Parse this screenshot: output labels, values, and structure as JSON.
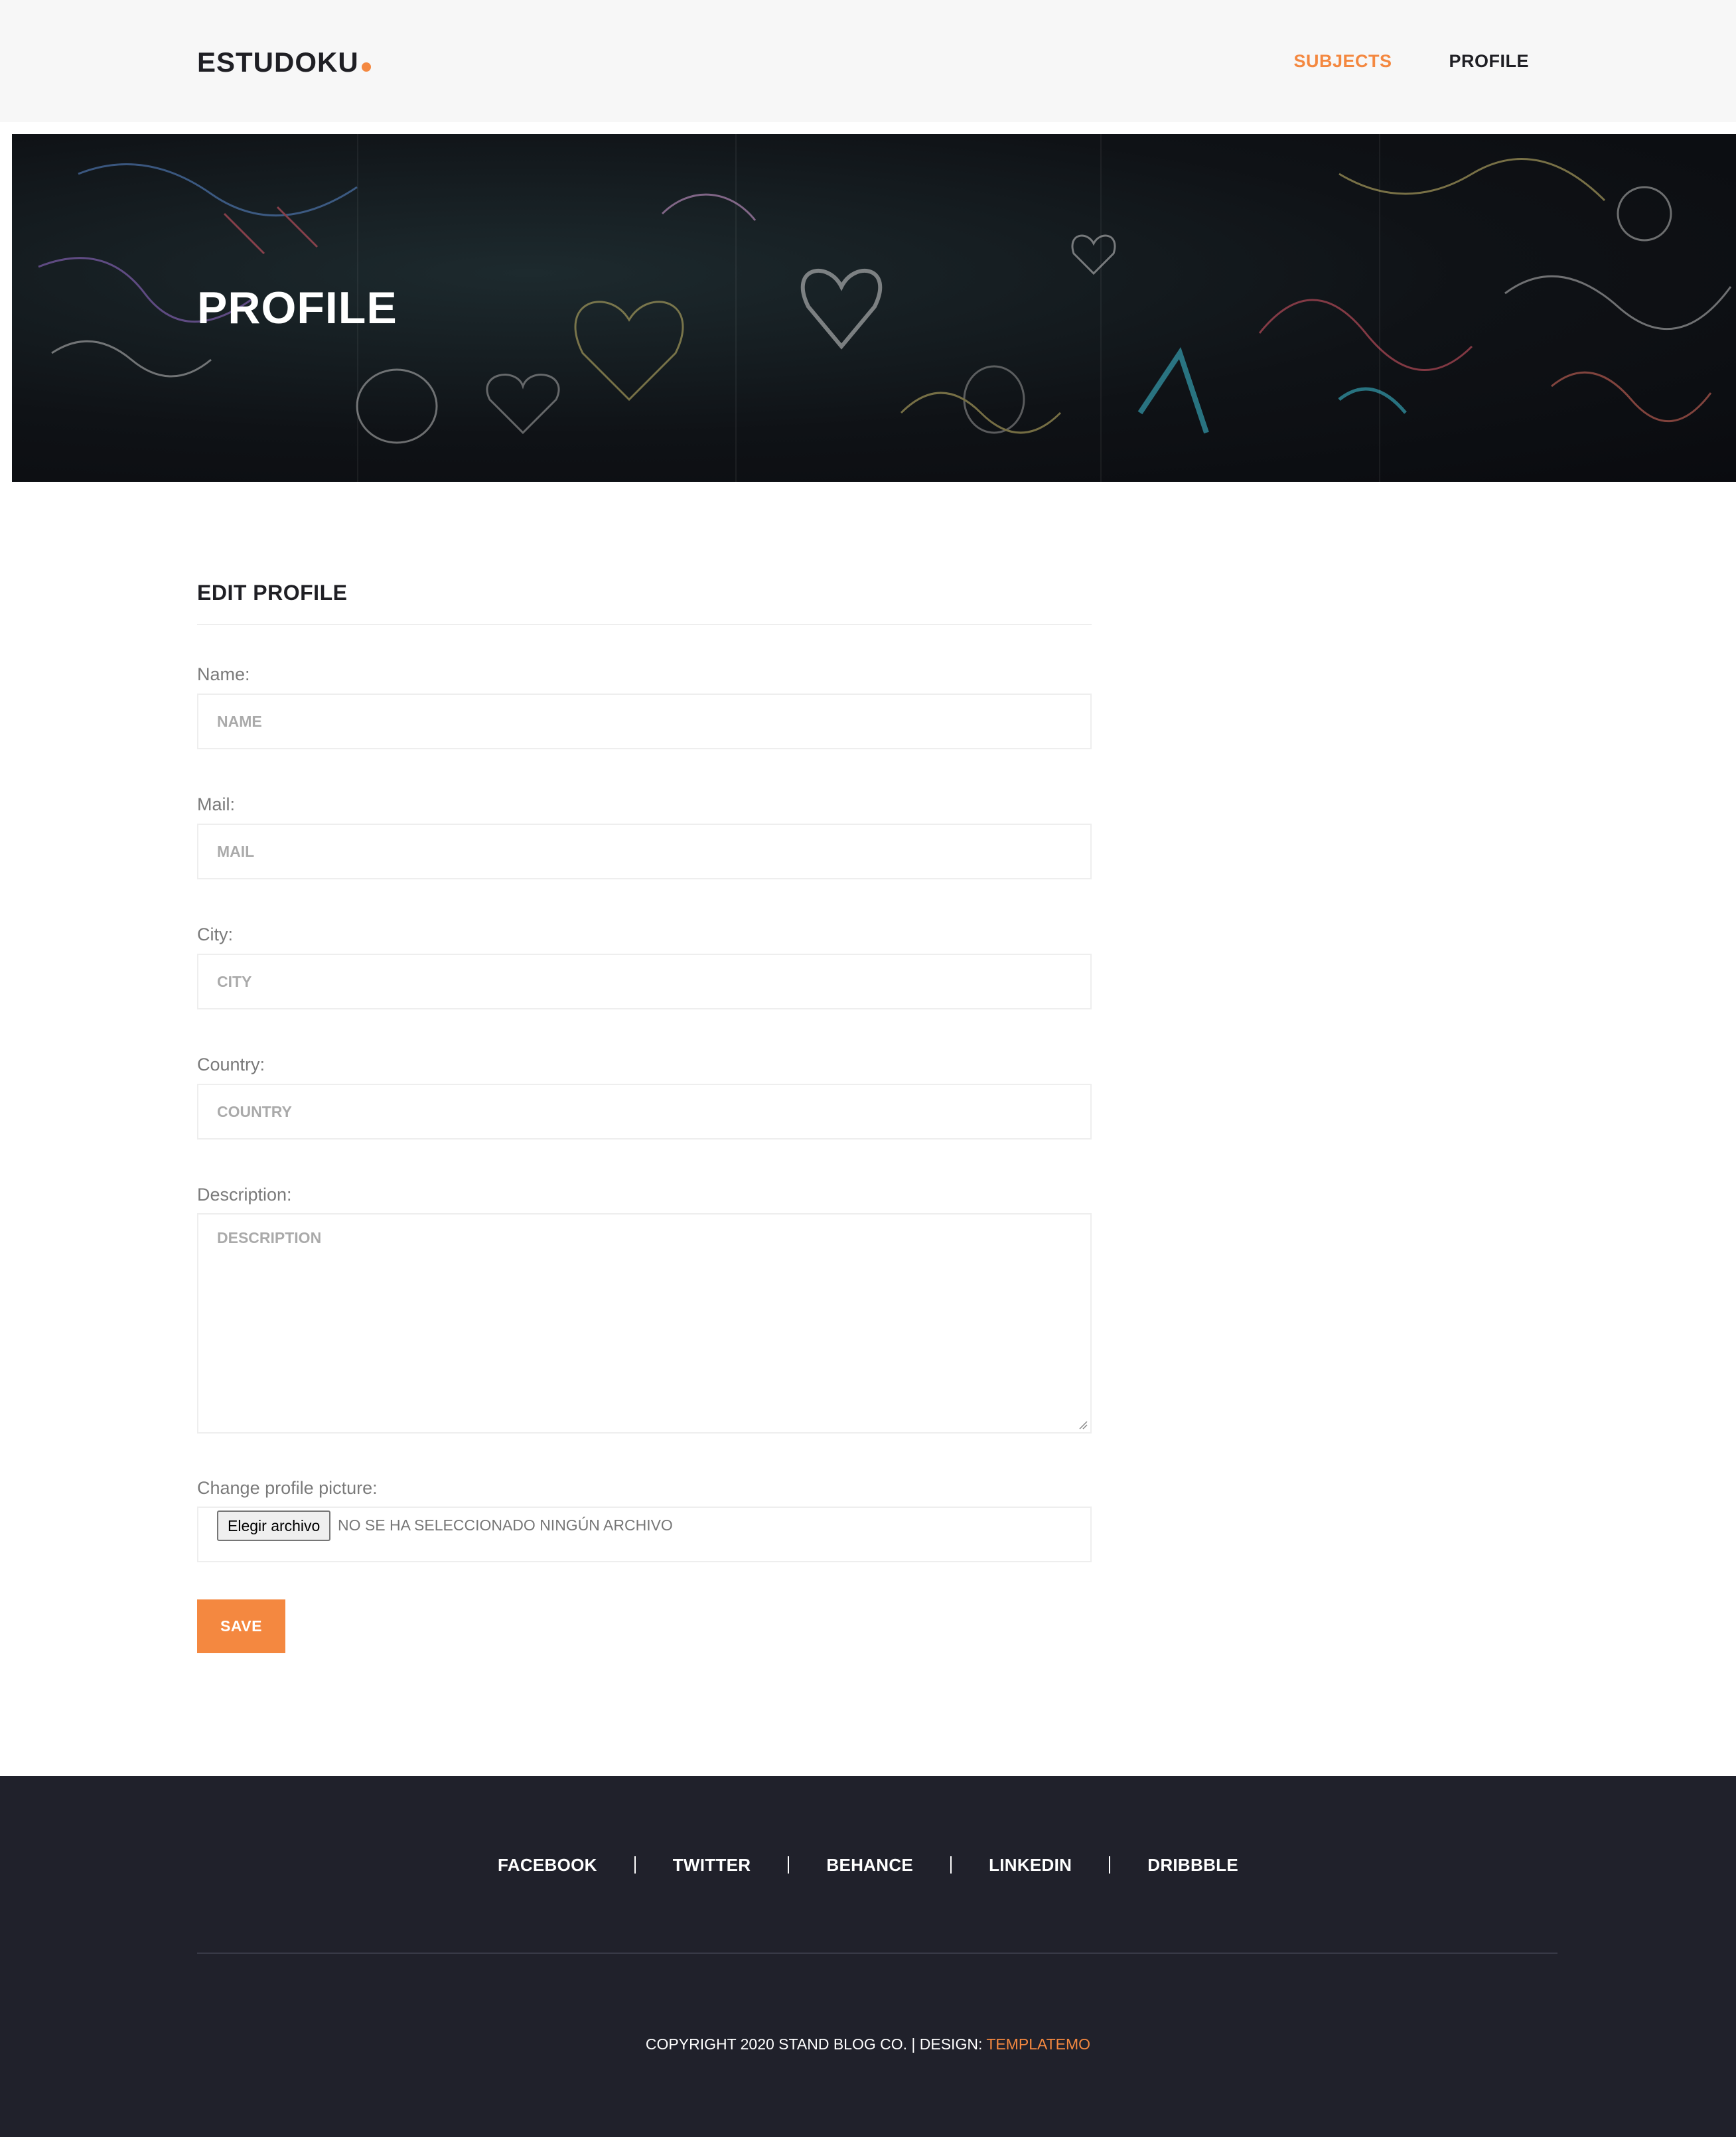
{
  "header": {
    "logo": "ESTUDOKU",
    "nav": [
      {
        "label": "SUBJECTS",
        "active": true
      },
      {
        "label": "PROFILE",
        "active": false
      }
    ]
  },
  "banner": {
    "title": "PROFILE"
  },
  "form": {
    "title": "EDIT PROFILE",
    "name": {
      "label": "Name:",
      "placeholder": "NAME",
      "value": ""
    },
    "mail": {
      "label": "Mail:",
      "placeholder": "MAIL",
      "value": ""
    },
    "city": {
      "label": "City:",
      "placeholder": "CITY",
      "value": ""
    },
    "country": {
      "label": "Country:",
      "placeholder": "COUNTRY",
      "value": ""
    },
    "description": {
      "label": "Description:",
      "placeholder": "DESCRIPTION",
      "value": ""
    },
    "picture": {
      "label": "Change profile picture:",
      "button_label": "Elegir archivo",
      "status": "NO SE HA SELECCIONADO NINGÚN ARCHIVO"
    },
    "save_label": "SAVE"
  },
  "footer": {
    "social": [
      "FACEBOOK",
      "TWITTER",
      "BEHANCE",
      "LINKEDIN",
      "DRIBBBLE"
    ],
    "copyright_text": "COPYRIGHT 2020 STAND BLOG CO. | DESIGN: ",
    "design_link": "TEMPLATEMO"
  },
  "colors": {
    "accent": "#f48840",
    "footer_bg": "#20212b",
    "header_bg": "#f7f7f7"
  }
}
